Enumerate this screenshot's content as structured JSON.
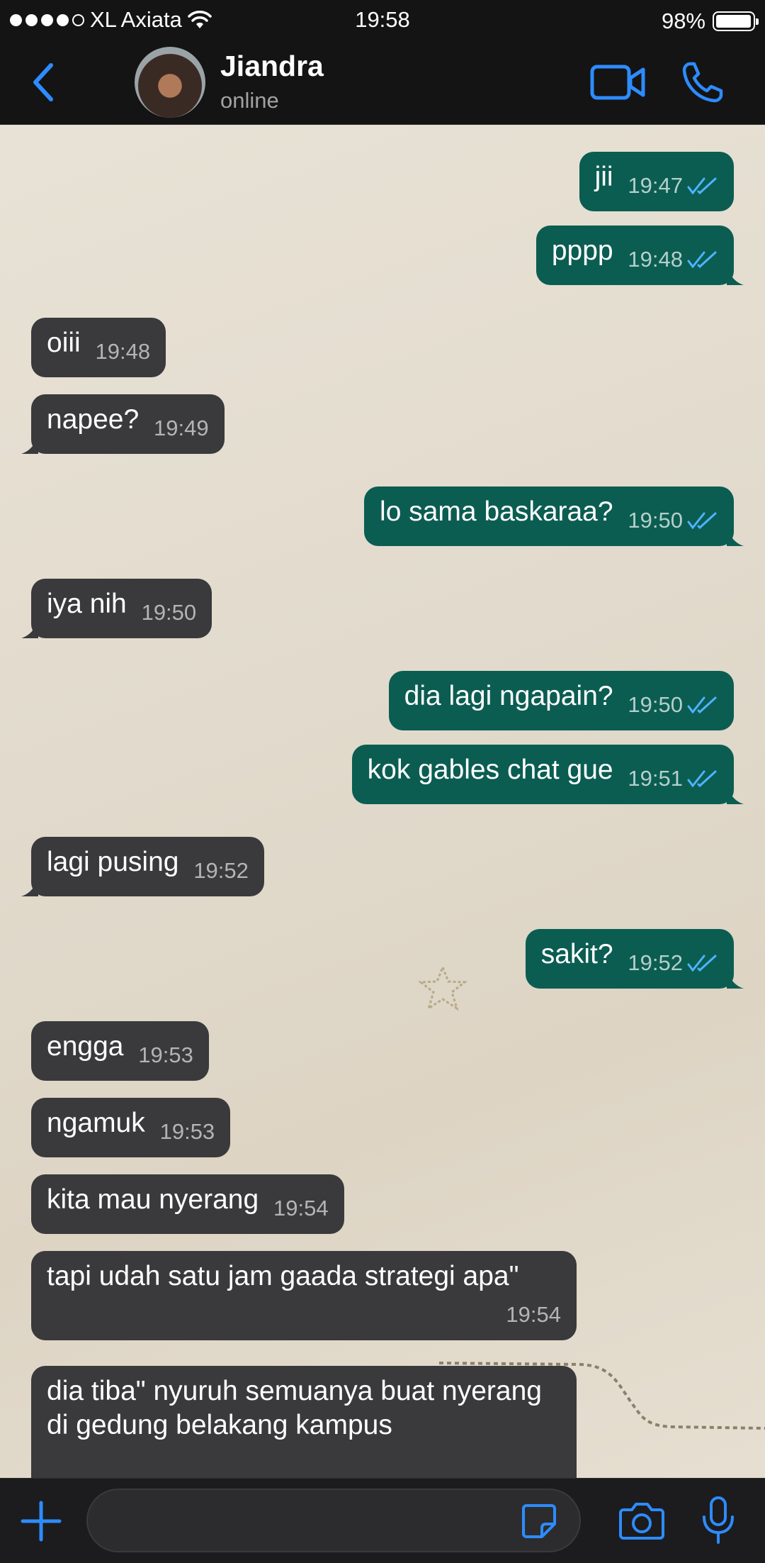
{
  "status_bar": {
    "carrier": "XL Axiata",
    "time": "19:58",
    "battery": "98%",
    "battery_level": 0.98,
    "signal_bars": 4
  },
  "header": {
    "name": "Jiandra",
    "status": "online"
  },
  "messages": [
    {
      "dir": "out",
      "text": "jii",
      "time": "19:47"
    },
    {
      "dir": "out",
      "text": "pppp",
      "time": "19:48"
    },
    {
      "dir": "in",
      "text": "oiii",
      "time": "19:48"
    },
    {
      "dir": "in",
      "text": "napee?",
      "time": "19:49"
    },
    {
      "dir": "out",
      "text": "lo sama baskaraa?",
      "time": "19:50"
    },
    {
      "dir": "in",
      "text": "iya nih",
      "time": "19:50"
    },
    {
      "dir": "out",
      "text": "dia lagi ngapain?",
      "time": "19:50"
    },
    {
      "dir": "out",
      "text": "kok gables chat gue",
      "time": "19:51"
    },
    {
      "dir": "in",
      "text": "lagi pusing",
      "time": "19:52"
    },
    {
      "dir": "out",
      "text": "sakit?",
      "time": "19:52"
    },
    {
      "dir": "in",
      "text": "engga",
      "time": "19:53"
    },
    {
      "dir": "in",
      "text": "ngamuk",
      "time": "19:53"
    },
    {
      "dir": "in",
      "text": "kita mau nyerang",
      "time": "19:54"
    },
    {
      "dir": "in",
      "text": "tapi udah satu jam gaada strategi apa\"",
      "time": "19:54"
    },
    {
      "dir": "in",
      "text": "dia tiba\" nyuruh semuanya buat nyerang di gedung belakang kampus",
      "time": ""
    }
  ],
  "colors": {
    "outgoing_bubble": "#0b5d52",
    "incoming_bubble": "#3a3a3c",
    "accent": "#2d8cff",
    "read_ticks": "#4fb3ff"
  },
  "icons": {
    "back": "chevron-left-icon",
    "video": "video-camera-icon",
    "call": "phone-icon",
    "attach": "plus-icon",
    "sticker": "sticker-icon",
    "camera": "camera-icon",
    "mic": "microphone-icon"
  }
}
